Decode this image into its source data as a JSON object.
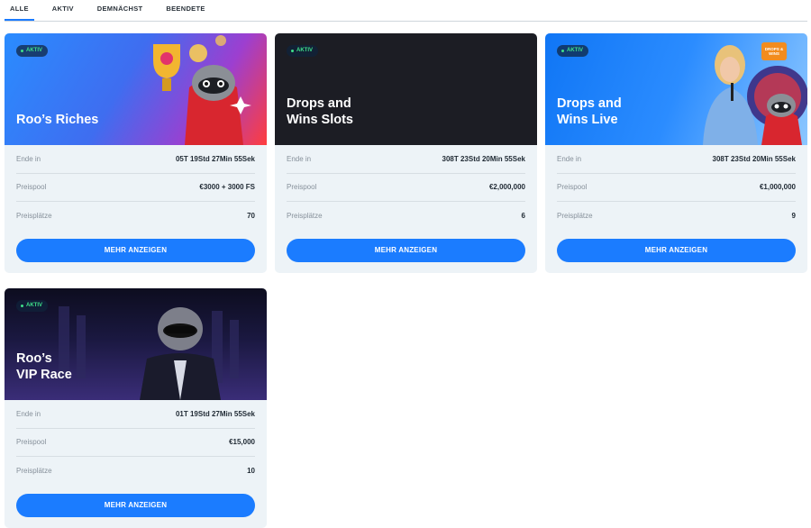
{
  "tabs": [
    {
      "label": "ALLE",
      "active": true
    },
    {
      "label": "AKTIV",
      "active": false
    },
    {
      "label": "DEMNÄCHST",
      "active": false
    },
    {
      "label": "BEENDETE",
      "active": false
    }
  ],
  "cards": [
    {
      "title": "Roo’s Riches",
      "badge": "AKTIV",
      "rows": [
        {
          "label": "Ende in",
          "value": "05T 19Std 27Min 55Sek"
        },
        {
          "label": "Preispool",
          "value": "€3000 + 3000 FS"
        },
        {
          "label": "Preisplätze",
          "value": "70"
        }
      ],
      "button": "MEHR ANZEIGEN"
    },
    {
      "title": "Drops and\nWins Slots",
      "badge": "AKTIV",
      "rows": [
        {
          "label": "Ende in",
          "value": "308T 23Std 20Min 55Sek"
        },
        {
          "label": "Preispool",
          "value": "€2,000,000"
        },
        {
          "label": "Preisplätze",
          "value": "6"
        }
      ],
      "button": "MEHR ANZEIGEN"
    },
    {
      "title": "Drops and\nWins Live",
      "badge": "AKTIV",
      "rows": [
        {
          "label": "Ende in",
          "value": "308T 23Std 20Min 55Sek"
        },
        {
          "label": "Preispool",
          "value": "€1,000,000"
        },
        {
          "label": "Preisplätze",
          "value": "9"
        }
      ],
      "button": "MEHR ANZEIGEN",
      "logo_text": "DROPS & WINS"
    },
    {
      "title": "Roo’s\nVIP Race",
      "badge": "AKTIV",
      "rows": [
        {
          "label": "Ende in",
          "value": "01T 19Std 27Min 55Sek"
        },
        {
          "label": "Preispool",
          "value": "€15,000"
        },
        {
          "label": "Preisplätze",
          "value": "10"
        }
      ],
      "button": "MEHR ANZEIGEN"
    }
  ],
  "colors": {
    "accent": "#1b7cff",
    "badge_green": "#3ee08a",
    "card_bg": "#edf3f7"
  }
}
